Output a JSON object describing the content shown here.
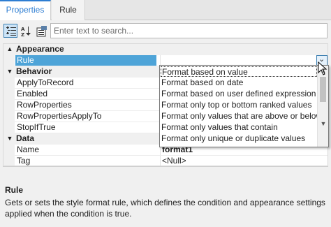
{
  "tabs": [
    {
      "label": "Properties",
      "active": true
    },
    {
      "label": "Rule",
      "active": false
    }
  ],
  "toolbar": {
    "buttons": [
      {
        "icon": "categorized-view-icon",
        "checked": true
      },
      {
        "icon": "alphabetical-sort-icon",
        "checked": false
      },
      {
        "icon": "property-pages-icon",
        "checked": false
      }
    ],
    "search_placeholder": "Enter text to search..."
  },
  "grid": {
    "categories": {
      "appearance": {
        "name": "Appearance",
        "expand_glyph": "▲"
      },
      "behavior": {
        "name": "Behavior",
        "expand_glyph": "▼"
      },
      "data": {
        "name": "Data",
        "expand_glyph": "▼"
      }
    },
    "props": {
      "rule": {
        "name": "Rule",
        "value": ""
      },
      "apply_to_record": {
        "name": "ApplyToRecord",
        "value": ""
      },
      "enabled": {
        "name": "Enabled",
        "value": ""
      },
      "row_properties": {
        "name": "RowProperties",
        "value": ""
      },
      "row_properties_apply_to": {
        "name": "RowPropertiesApplyTo",
        "value": ""
      },
      "stop_if_true": {
        "name": "StopIfTrue",
        "value": ""
      },
      "name": {
        "name": "Name",
        "value": "format1"
      },
      "tag": {
        "name": "Tag",
        "value": "<Null>"
      }
    },
    "dropdown_glyph": "⌄"
  },
  "dropdown": {
    "items": [
      "Format based on value",
      "Format based on date",
      "Format based on user defined expression",
      "Format only top or bottom ranked values",
      "Format only values that are above or below a",
      "Format only values that contain",
      "Format only unique or duplicate values"
    ],
    "selected_index": 0,
    "scroll_up_glyph": "▲",
    "scroll_down_glyph": "▼"
  },
  "description": {
    "title": "Rule",
    "text": "Gets or sets the style format rule, which defines the condition and appearance settings applied when the condition is true."
  },
  "colors": {
    "accent": "#2d7dd2",
    "selection": "#4ea4d8"
  }
}
